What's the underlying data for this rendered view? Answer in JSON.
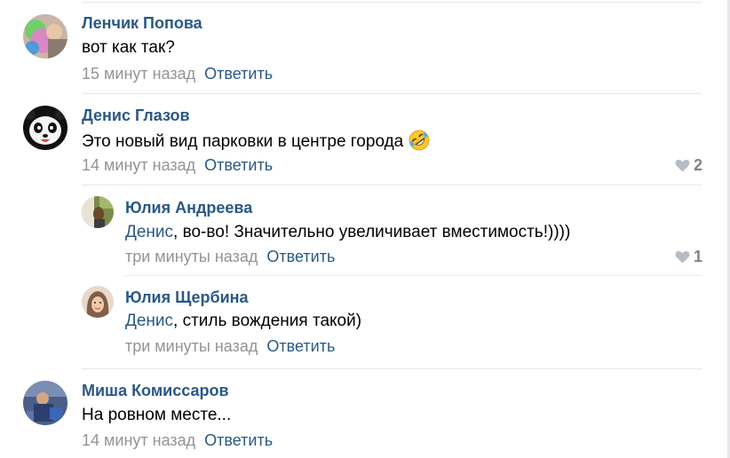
{
  "comments": [
    {
      "author": "Ленчик Попова",
      "text": "вот как так?",
      "time": "15 минут назад",
      "reply_label": "Ответить"
    },
    {
      "author": "Денис Глазов",
      "text": "Это новый вид парковки в центре города",
      "time": "14 минут назад",
      "reply_label": "Ответить",
      "likes": "2",
      "replies": [
        {
          "author": "Юлия Андреева",
          "mention": "Денис",
          "text": ", во-во! Значительно увеличивает вместимость!))))",
          "time": "три минуты назад",
          "reply_label": "Ответить",
          "likes": "1"
        },
        {
          "author": "Юлия Щербина",
          "mention": "Денис",
          "text": ", стиль вождения такой)",
          "time": "три минуты назад",
          "reply_label": "Ответить"
        }
      ]
    },
    {
      "author": "Миша Комиссаров",
      "text": "На ровном месте...",
      "time": "14 минут назад",
      "reply_label": "Ответить"
    }
  ],
  "icons": {
    "like": "heart-icon",
    "emoji": "rolling-on-floor-laughing-emoji"
  },
  "colors": {
    "link": "#2a5885",
    "meta": "#939393",
    "like": "#828282",
    "separator": "#e7e8ec"
  }
}
